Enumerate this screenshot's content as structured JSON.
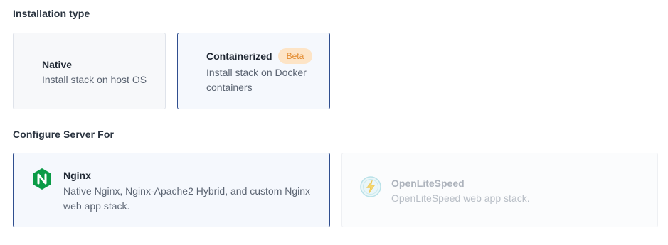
{
  "installation": {
    "title": "Installation type",
    "options": [
      {
        "title": "Native",
        "description": "Install stack on host OS",
        "selected": false
      },
      {
        "title": "Containerized",
        "badge": "Beta",
        "description": "Install stack on Docker containers",
        "selected": true
      }
    ]
  },
  "server": {
    "title": "Configure Server For",
    "options": [
      {
        "title": "Nginx",
        "description": "Native Nginx, Nginx-Apache2 Hybrid, and custom Nginx web app stack.",
        "icon": "nginx-logo-icon",
        "selected": true
      },
      {
        "title": "OpenLiteSpeed",
        "description": "OpenLiteSpeed web app stack.",
        "icon": "openlitespeed-logo-icon",
        "selected": false,
        "disabled": true
      }
    ]
  },
  "colors": {
    "selected_border": "#2f4e8f",
    "beta_badge_bg": "#fde4c6",
    "beta_badge_text": "#e28a2e",
    "nginx_green": "#0a9b46"
  }
}
